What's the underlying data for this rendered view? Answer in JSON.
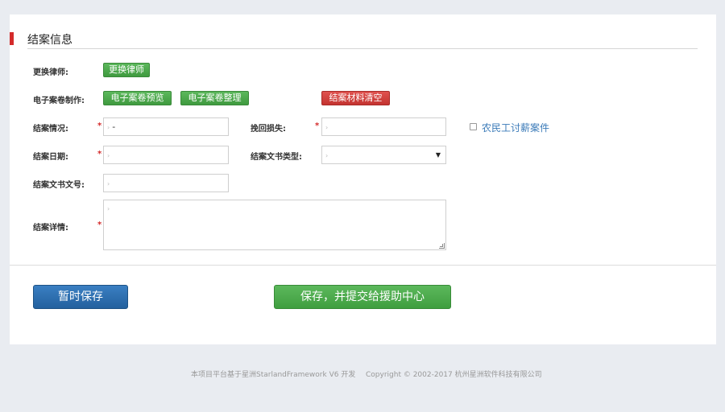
{
  "section": {
    "title": "结案信息"
  },
  "fields": {
    "change_lawyer_label": "更换律师:",
    "change_lawyer_button": "更换律师",
    "ecase_label": "电子案卷制作:",
    "ecase_preview_button": "电子案卷预览",
    "ecase_organize_button": "电子案卷整理",
    "clear_materials_button": "结案材料清空",
    "case_status_label": "结案情况:",
    "case_status_value": "-",
    "recovered_loss_label": "挽回损失:",
    "recovered_loss_value": "",
    "migrant_wage_label": "农民工讨薪案件",
    "close_date_label": "结案日期:",
    "close_date_value": "",
    "doc_type_label": "结案文书类型:",
    "doc_type_value": "",
    "doc_number_label": "结案文书文号:",
    "doc_number_value": "",
    "details_label": "结案详情:",
    "details_value": "",
    "required_mark": "*"
  },
  "actions": {
    "temp_save": "暂时保存",
    "save_submit": "保存，并提交给援助中心"
  },
  "footer": {
    "left": "本项目平台基于星洲StarlandFramework V6 开发",
    "right": "Copyright © 2002-2017 杭州星洲软件科技有限公司"
  },
  "colors": {
    "accent_red": "#d42b2b",
    "button_green": "#4cae4c",
    "button_blue": "#2d6fb0",
    "link_blue": "#3a7ab8"
  },
  "icons": {
    "checkbox": "checkbox-icon",
    "select_arrow": "caret-down-icon"
  }
}
